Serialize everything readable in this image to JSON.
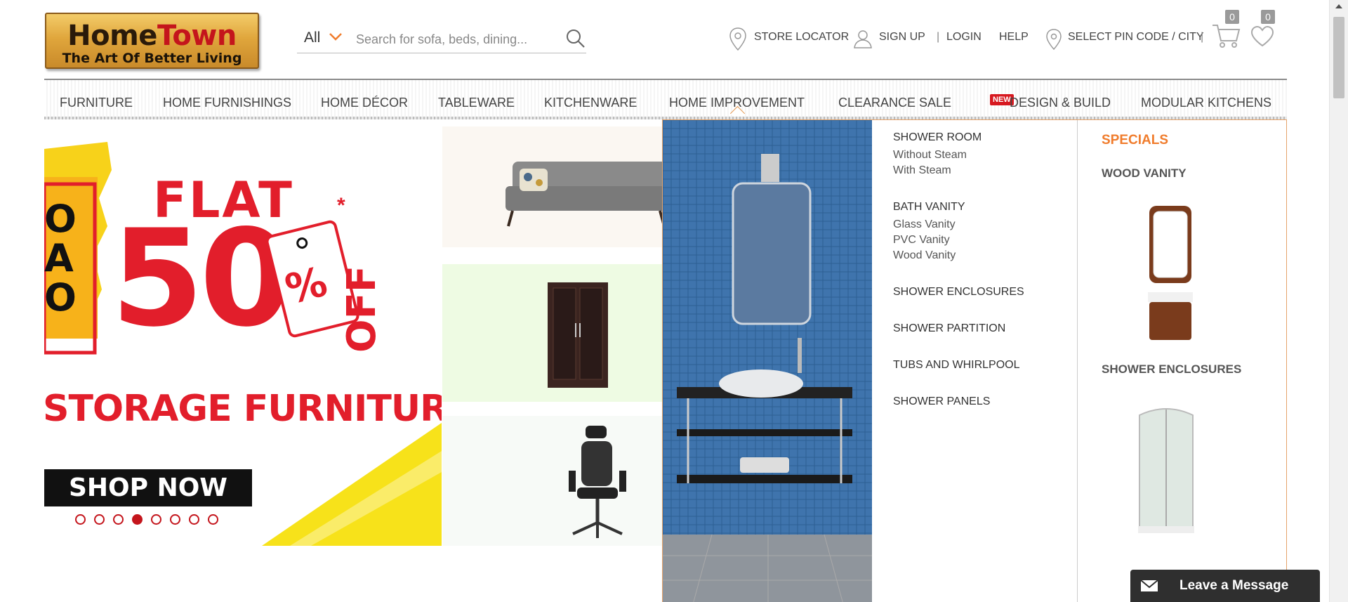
{
  "brand": {
    "name_part1": "Home",
    "name_part2": "Town",
    "tagline": "The Art Of Better Living"
  },
  "search": {
    "category": "All",
    "placeholder": "Search for sofa, beds, dining..."
  },
  "top_links": {
    "store_locator": "STORE LOCATOR",
    "sign_up": "SIGN UP",
    "separator": "|",
    "login": "LOGIN",
    "help": "HELP",
    "pin_code": "SELECT PIN CODE / CITY",
    "cart_count": "0",
    "wishlist_count": "0"
  },
  "nav": {
    "items": [
      {
        "label": "FURNITURE"
      },
      {
        "label": "HOME FURNISHINGS"
      },
      {
        "label": "HOME DÉCOR"
      },
      {
        "label": "TABLEWARE"
      },
      {
        "label": "KITCHENWARE"
      },
      {
        "label": "HOME IMPROVEMENT"
      },
      {
        "label": "CLEARANCE SALE"
      },
      {
        "label": "DESIGN & BUILD"
      },
      {
        "label": "MODULAR KITCHENS"
      }
    ],
    "new_badge": "NEW",
    "active_index": 5
  },
  "hero": {
    "headline_top": "FLAT",
    "headline_value": "50",
    "percent_symbol": "%",
    "off_text": "OFF",
    "asterisk": "*",
    "subline": "STORAGE FURNITURE",
    "cta": "SHOP NOW",
    "left_edge_letters": "OAO",
    "slide_count": 8,
    "active_slide": 3
  },
  "mega_menu": {
    "groups": [
      {
        "title": "SHOWER ROOM",
        "items": [
          "Without Steam",
          "With Steam"
        ]
      },
      {
        "title": "BATH VANITY",
        "items": [
          "Glass Vanity",
          "PVC Vanity",
          "Wood Vanity"
        ]
      },
      {
        "title": "SHOWER ENCLOSURES",
        "items": []
      },
      {
        "title": "SHOWER PARTITION",
        "items": []
      },
      {
        "title": "TUBS AND WHIRLPOOL",
        "items": []
      },
      {
        "title": "SHOWER PANELS",
        "items": []
      }
    ],
    "specials": {
      "title": "SPECIALS",
      "items": [
        {
          "label": "WOOD VANITY"
        },
        {
          "label": "SHOWER ENCLOSURES"
        }
      ]
    }
  },
  "chat": {
    "label": "Leave a Message"
  },
  "colors": {
    "accent_orange": "#f07c2c",
    "brand_red": "#e21e2b",
    "badge_red": "#d71920",
    "hero_yellow": "#f7e21a",
    "tile_beige": "#fbf7f2",
    "tile_green": "#eefbe3",
    "tile_white": "#f7faf7",
    "chat_bg": "#2f2f2f"
  }
}
